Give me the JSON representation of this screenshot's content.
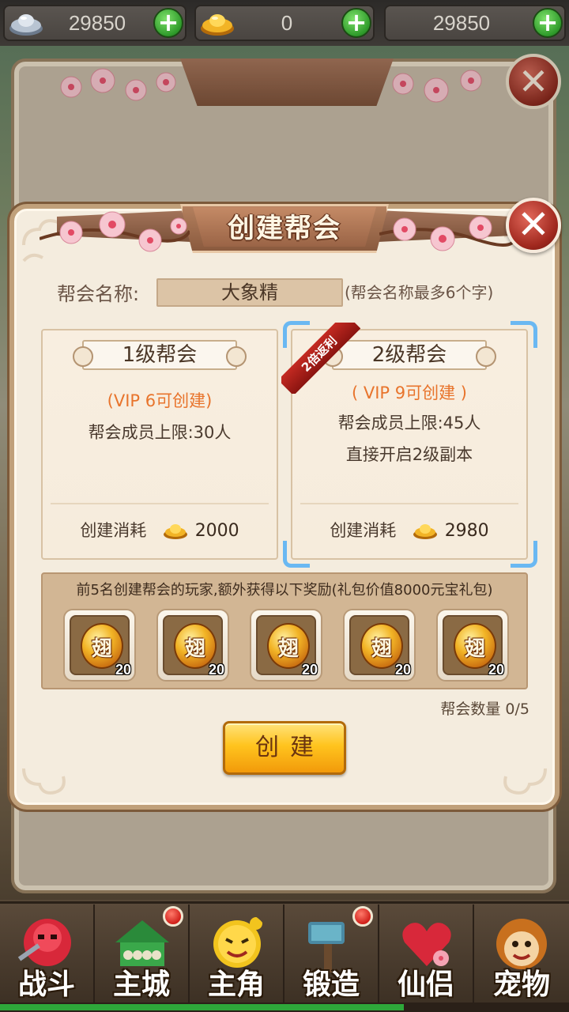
{
  "topbar": {
    "silver": {
      "value": "29850",
      "icon": "silver-ingot-icon"
    },
    "gold": {
      "value": "0",
      "icon": "gold-ingot-icon"
    },
    "third": {
      "value": "29850"
    },
    "plus_label": "+"
  },
  "dialog": {
    "title": "创建帮会",
    "close_label": "✕",
    "name_label": "帮会名称:",
    "name_value": "大象精",
    "name_hint": "(帮会名称最多6个字)",
    "cards": [
      {
        "title": "1级帮会",
        "vip": "(VIP 6可创建)",
        "members": "帮会成员上限:30人",
        "extra": "",
        "cost_label": "创建消耗",
        "cost": "2000",
        "selected": false
      },
      {
        "title": "2级帮会",
        "vip": "( VIP 9可创建 )",
        "members": "帮会成员上限:45人",
        "extra": "直接开启2级副本",
        "cost_label": "创建消耗",
        "cost": "2980",
        "badge": "2倍返利",
        "selected": true
      }
    ],
    "reward_title": "前5名创建帮会的玩家,额外获得以下奖励(礼包价值8000元宝礼包)",
    "rewards": [
      {
        "glyph": "翅",
        "count": "20"
      },
      {
        "glyph": "翅",
        "count": "20"
      },
      {
        "glyph": "翅",
        "count": "20"
      },
      {
        "glyph": "翅",
        "count": "20"
      },
      {
        "glyph": "翅",
        "count": "20"
      }
    ],
    "guild_count": "帮会数量  0/5",
    "create_button": "创建"
  },
  "nav": {
    "items": [
      {
        "label": "战斗",
        "icon": "battle-icon",
        "badge": false
      },
      {
        "label": "主城",
        "icon": "main-city-icon",
        "badge": true
      },
      {
        "label": "主角",
        "icon": "hero-icon",
        "badge": false
      },
      {
        "label": "锻造",
        "icon": "forge-icon",
        "badge": true
      },
      {
        "label": "仙侣",
        "icon": "partner-icon",
        "badge": false
      },
      {
        "label": "宠物",
        "icon": "pet-icon",
        "badge": false
      }
    ],
    "progress": 0.71
  },
  "colors": {
    "accent_orange": "#e8742c",
    "select_blue": "#6ab8f2",
    "button_gold": "#ffc41e",
    "close_red": "#a0281e"
  }
}
